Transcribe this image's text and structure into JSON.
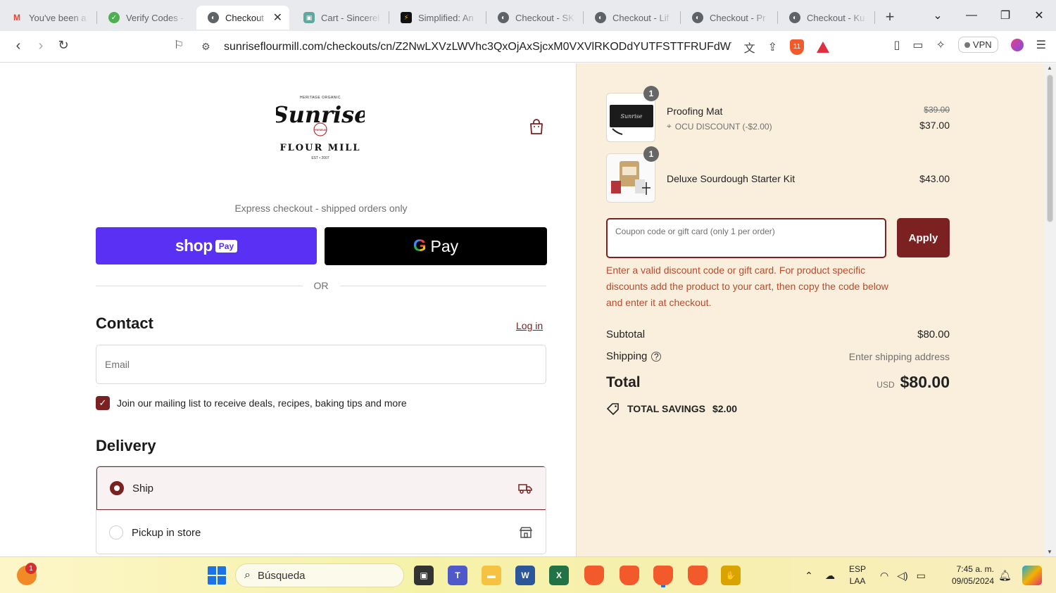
{
  "browser": {
    "tabs": [
      {
        "title": "You've been a",
        "icon": "gmail-icon",
        "icon_color": "#ea4335"
      },
      {
        "title": "Verify Codes -",
        "icon": "check-icon",
        "icon_color": "#4caf50"
      },
      {
        "title": "Checkout",
        "icon": "globe-icon",
        "icon_color": "#5f6368",
        "active": true
      },
      {
        "title": "Cart - Sincerel",
        "icon": "cart-favicon",
        "icon_color": "#5fa8a0"
      },
      {
        "title": "Simplified: An",
        "icon": "simplified-icon",
        "icon_color": "#111111"
      },
      {
        "title": "Checkout - SK",
        "icon": "globe-icon",
        "icon_color": "#5f6368"
      },
      {
        "title": "Checkout - Lif",
        "icon": "globe-icon",
        "icon_color": "#5f6368"
      },
      {
        "title": "Checkout - Pr",
        "icon": "globe-icon",
        "icon_color": "#5f6368"
      },
      {
        "title": "Checkout - Ku",
        "icon": "globe-icon",
        "icon_color": "#5f6368"
      }
    ],
    "url": "sunriseflourmill.com/checkouts/cn/Z2NwLXVzLWVhc3QxOjAxSjcxM0VXVlRKODdYUTFSTTFRUFdWT...",
    "shield_count": "11",
    "vpn_label": "VPN"
  },
  "checkout": {
    "express_label": "Express checkout - shipped orders only",
    "shoppay_word": "shop",
    "shoppay_badge": "Pay",
    "gpay_letter": "G",
    "gpay_word": "Pay",
    "or_label": "OR",
    "contact_title": "Contact",
    "login_label": "Log in",
    "email_placeholder": "Email",
    "newsletter_label": "Join our mailing list to receive deals, recipes, baking tips and more",
    "newsletter_checked": true,
    "delivery_title": "Delivery",
    "delivery_options": [
      {
        "label": "Ship",
        "selected": true,
        "icon": "truck-icon"
      },
      {
        "label": "Pickup in store",
        "selected": false,
        "icon": "store-icon"
      }
    ]
  },
  "summary": {
    "items": [
      {
        "name": "Proofing Mat",
        "qty": "1",
        "original_price": "$39.00",
        "price": "$37.00",
        "discount": "OCU DISCOUNT (-$2.00)"
      },
      {
        "name": "Deluxe Sourdough Starter Kit",
        "qty": "1",
        "price": "$43.00"
      }
    ],
    "coupon_placeholder": "Coupon code or gift card (only 1 per order)",
    "apply_label": "Apply",
    "coupon_error": "Enter a valid discount code or gift card. For product specific discounts add the product to your cart, then copy the code below and enter it at checkout.",
    "subtotal_label": "Subtotal",
    "subtotal_value": "$80.00",
    "shipping_label": "Shipping",
    "shipping_value": "Enter shipping address",
    "total_label": "Total",
    "total_currency": "USD",
    "total_value": "$80.00",
    "savings_label": "TOTAL SAVINGS",
    "savings_value": "$2.00"
  },
  "taskbar": {
    "search_placeholder": "Búsqueda",
    "notification_count": "1",
    "lang_top": "ESP",
    "lang_bottom": "LAA",
    "time": "7:45 a. m.",
    "date": "09/05/2024"
  },
  "colors": {
    "brand": "#7b2121",
    "summary_bg": "#faefdd",
    "shoppay": "#5a31f4",
    "error": "#b94a2d"
  }
}
